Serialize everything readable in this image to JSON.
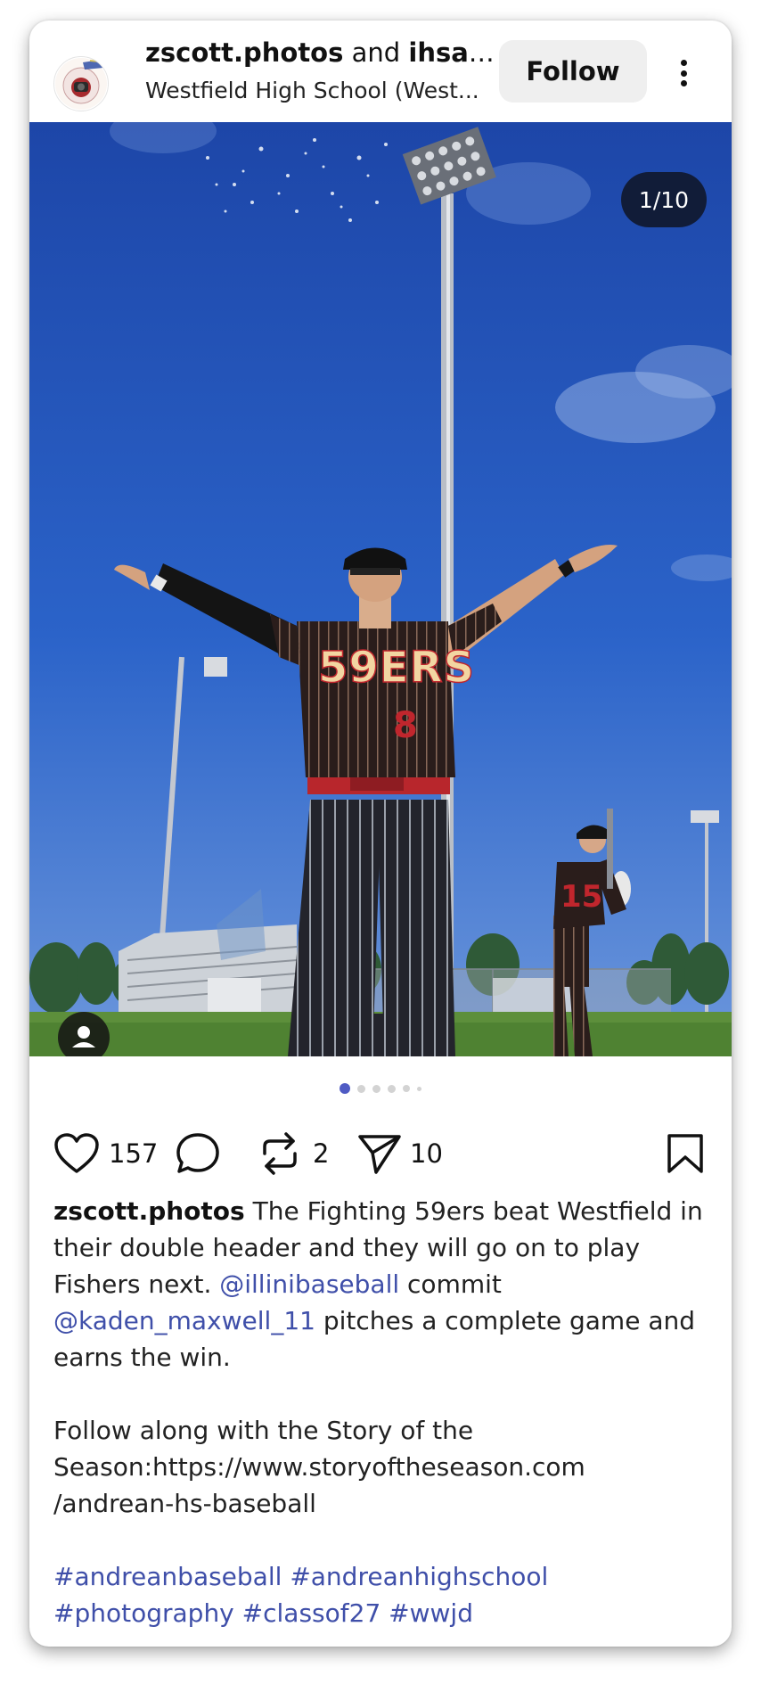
{
  "post": {
    "author": "zscott.photos",
    "connector": "and",
    "coauthor": "ihsaa....",
    "location": "Westfield High School (West...",
    "follow_label": "Follow",
    "media_counter": "1/10"
  },
  "carousel": {
    "total_dots": 6,
    "active_index": 0
  },
  "actions": {
    "likes": "157",
    "reposts": "2",
    "shares": "10"
  },
  "caption": {
    "username": "zscott.photos",
    "part1": " The Fighting 59ers beat Westfield in their double header and they will go on to play Fishers next. ",
    "mention1": "@illinibaseball",
    "part2": " commit ",
    "mention2": "@kaden_maxwell_11",
    "part3": " pitches a complete game and earns the win.",
    "paragraph2": "Follow along with the Story of the Season:https://www.storyoftheseason.com /andrean-hs-baseball",
    "hashtag1": "#andreanbaseball",
    "hashtag2": "#andreanhighschool",
    "hashtag3": "#photography",
    "hashtag4": "#classof27",
    "hashtag5": "#wwjd"
  },
  "colors": {
    "link": "#3f4fa9",
    "active_dot": "#4f5bc4",
    "sky": "#1f4fb8",
    "jersey_text": "#f2d6a2",
    "accent_red": "#c0262d"
  }
}
